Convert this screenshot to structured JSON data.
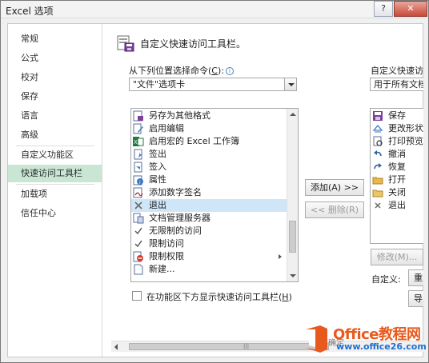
{
  "window": {
    "title": "Excel 选项",
    "help_glyph": "?",
    "close_glyph": "✕"
  },
  "sidebar": {
    "items": [
      {
        "label": "常规"
      },
      {
        "label": "公式"
      },
      {
        "label": "校对"
      },
      {
        "label": "保存"
      },
      {
        "label": "语言"
      },
      {
        "label": "高级"
      },
      {
        "label": "自定义功能区"
      },
      {
        "label": "快速访问工具栏",
        "active": true
      },
      {
        "label": "加载项"
      },
      {
        "label": "信任中心"
      }
    ]
  },
  "main": {
    "heading": "自定义快速访问工具栏。",
    "choose_label": "从下列位置选择命令(",
    "choose_key": "C",
    "choose_suffix": "):",
    "choose_value": "\"文件\"选项卡",
    "customize_label": "自定义快速访",
    "customize_value": "用于所有文档(",
    "commands": [
      {
        "label": "另存为其他格式",
        "icon": "save-as-icon"
      },
      {
        "label": "启用编辑",
        "icon": "enable-editing-icon"
      },
      {
        "label": "启用宏的 Excel 工作簿",
        "icon": "excel-macro-workbook-icon"
      },
      {
        "label": "签出",
        "icon": "check-out-icon"
      },
      {
        "label": "签入",
        "icon": "check-in-icon"
      },
      {
        "label": "属性",
        "icon": "properties-icon"
      },
      {
        "label": "添加数字签名",
        "icon": "digital-signature-icon"
      },
      {
        "label": "退出",
        "icon": "exit-icon",
        "selected": true
      },
      {
        "label": "文档管理服务器",
        "icon": "document-server-icon"
      },
      {
        "label": "无限制的访问",
        "icon": "unrestricted-access-icon"
      },
      {
        "label": "限制访问",
        "icon": "restrict-access-icon"
      },
      {
        "label": "限制权限",
        "icon": "restrict-permission-icon",
        "submenu": true
      },
      {
        "label": "新建...",
        "icon": "new-document-icon"
      }
    ],
    "add_button": "添加(A) >>",
    "remove_button": "<< 删除(R)",
    "toolbar_items": [
      {
        "label": "保存",
        "icon": "save-icon"
      },
      {
        "label": "更改形状",
        "icon": "change-shape-icon"
      },
      {
        "label": "打印预览",
        "icon": "print-preview-icon"
      },
      {
        "label": "撤消",
        "icon": "undo-icon"
      },
      {
        "label": "恢复",
        "icon": "redo-icon"
      },
      {
        "label": "打开",
        "icon": "open-folder-icon"
      },
      {
        "label": "关闭",
        "icon": "close-folder-icon"
      },
      {
        "label": "退出",
        "icon": "exit-icon"
      }
    ],
    "modify_button": "修改(M)...",
    "customizations_label": "自定义:",
    "reset_button": "重置",
    "import_button": "导入",
    "show_below_label": "在功能区下方显示快速访问工具栏(",
    "show_below_key": "H",
    "show_below_suffix": ")",
    "ok_partial": "确定"
  },
  "watermark": {
    "brand": "Office教程网",
    "url": "www.office26.com"
  },
  "colors": {
    "nav_active": "#c9e6d4",
    "selection": "#cfe6f8",
    "watermark_orange": "#e8591d",
    "watermark_blue": "#1f6fcf"
  }
}
